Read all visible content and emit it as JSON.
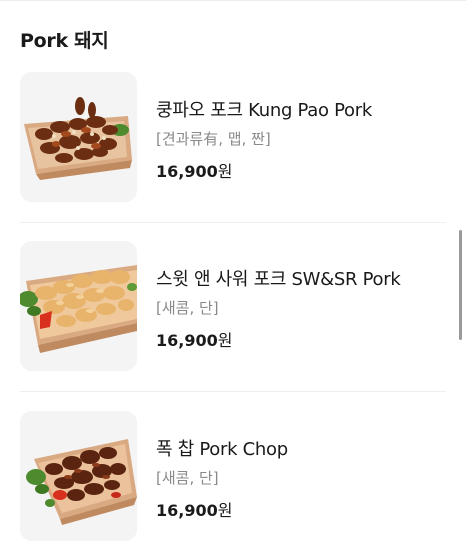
{
  "section": {
    "title": "Pork 돼지"
  },
  "items": [
    {
      "name": "쿵파오 포크 Kung Pao Pork",
      "tags": "[견과류有, 맵, 짠]",
      "price_amount": "16,900",
      "price_unit": "원",
      "image": "kung-pao-pork-photo"
    },
    {
      "name": "스윗 앤 사워 포크 SW&SR Pork",
      "tags": "[새콤, 단]",
      "price_amount": "16,900",
      "price_unit": "원",
      "image": "sweet-and-sour-pork-photo"
    },
    {
      "name": "폭 찹 Pork Chop",
      "tags": "[새콤, 단]",
      "price_amount": "16,900",
      "price_unit": "원",
      "image": "pork-chop-photo"
    }
  ],
  "colors": {
    "text_primary": "#1a1a1a",
    "text_secondary": "#8a8a8a",
    "thumb_bg": "#f4f4f4",
    "container": "#d7a47f",
    "divider": "#efefef"
  }
}
